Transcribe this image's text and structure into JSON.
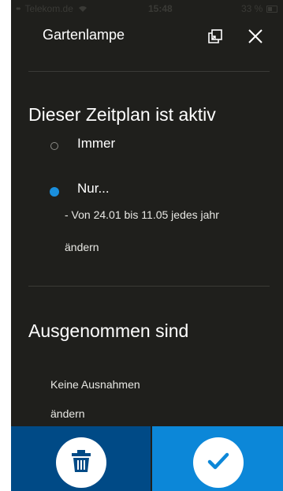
{
  "status_bar": {
    "carrier": "Telekom.de",
    "time": "15:48",
    "battery": "33 %"
  },
  "header": {
    "title": "Gartenlampe",
    "copy_icon": "copy-icon",
    "close_icon": "close-icon"
  },
  "schedule": {
    "heading": "Dieser Zeitplan ist aktiv",
    "options": [
      {
        "label": "Immer",
        "selected": false
      },
      {
        "label": "Nur...",
        "selected": true
      }
    ],
    "detail": "- Von 24.01 bis 11.05 jedes jahr",
    "change_link": "ändern"
  },
  "exceptions": {
    "heading": "Ausgenommen sind",
    "value": "Keine Ausnahmen",
    "change_link": "ändern"
  },
  "actions": {
    "delete_icon": "trash-icon",
    "confirm_icon": "checkmark-icon"
  },
  "colors": {
    "background": "#1f1f1c",
    "radio_selected": "#1a8fdd",
    "delete_bg": "#004a86",
    "confirm_bg": "#0c87d8"
  }
}
